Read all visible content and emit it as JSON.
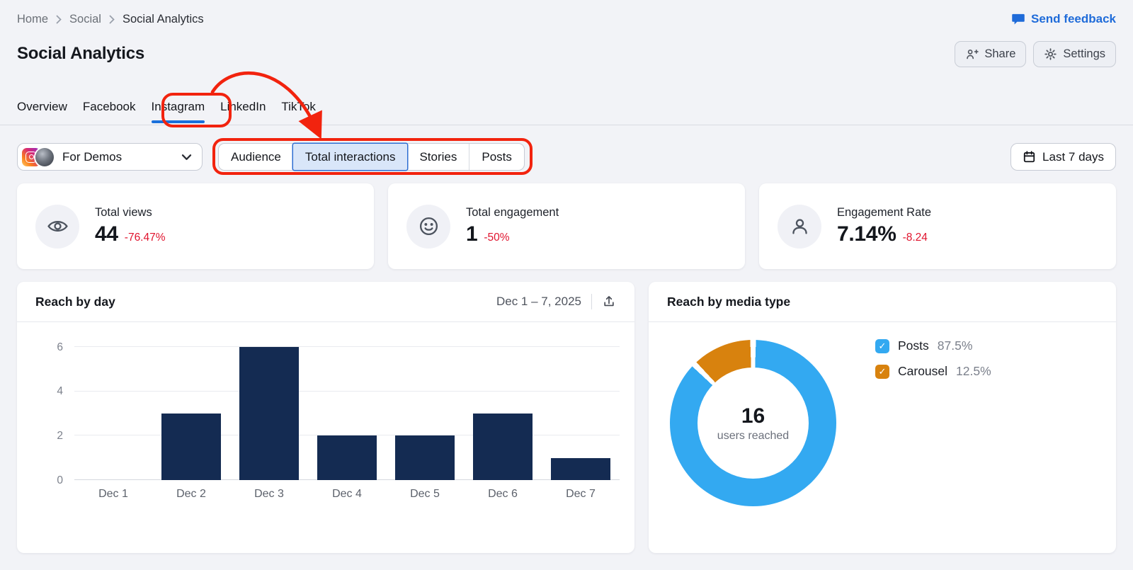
{
  "breadcrumb": {
    "items": [
      "Home",
      "Social",
      "Social Analytics"
    ]
  },
  "feedback": {
    "label": "Send feedback"
  },
  "page": {
    "title": "Social Analytics"
  },
  "actions": {
    "share_label": "Share",
    "settings_label": "Settings"
  },
  "tabs": {
    "items": [
      "Overview",
      "Facebook",
      "Instagram",
      "LinkedIn",
      "TikTok"
    ],
    "active_index": 2
  },
  "profile_selector": {
    "label": "For Demos"
  },
  "subtabs": {
    "items": [
      "Audience",
      "Total interactions",
      "Stories",
      "Posts"
    ],
    "active_index": 1
  },
  "date_filter": {
    "label": "Last 7 days"
  },
  "metrics": [
    {
      "label": "Total views",
      "value": "44",
      "change": "-76.47%",
      "icon": "eye-icon"
    },
    {
      "label": "Total engagement",
      "value": "1",
      "change": "-50%",
      "icon": "smiley-icon"
    },
    {
      "label": "Engagement Rate",
      "value": "7.14%",
      "change": "-8.24",
      "icon": "person-icon"
    }
  ],
  "colors": {
    "accent_blue": "#1a6fdb",
    "negative_red": "#e0142e",
    "annotation_red": "#f2230e"
  },
  "chart_data": [
    {
      "type": "bar",
      "title": "Reach by day",
      "date_range": "Dec 1 – 7, 2025",
      "categories": [
        "Dec 1",
        "Dec 2",
        "Dec 3",
        "Dec 4",
        "Dec 5",
        "Dec 6",
        "Dec 7"
      ],
      "values": [
        0,
        3,
        6,
        2,
        2,
        3,
        1
      ],
      "xlabel": "",
      "ylabel": "",
      "ylim": [
        0,
        6
      ],
      "yticks": [
        0,
        2,
        4,
        6
      ],
      "grid": true,
      "bar_color": "#142b52",
      "legend_position": "none"
    },
    {
      "type": "pie",
      "title": "Reach by media type",
      "center_value": "16",
      "center_label": "users reached",
      "slices": [
        {
          "name": "Posts",
          "pct": 87.5,
          "pct_label": "87.5%",
          "color": "#33a9f1"
        },
        {
          "name": "Carousel",
          "pct": 12.5,
          "pct_label": "12.5%",
          "color": "#d8820e"
        }
      ],
      "legend_position": "right"
    }
  ]
}
